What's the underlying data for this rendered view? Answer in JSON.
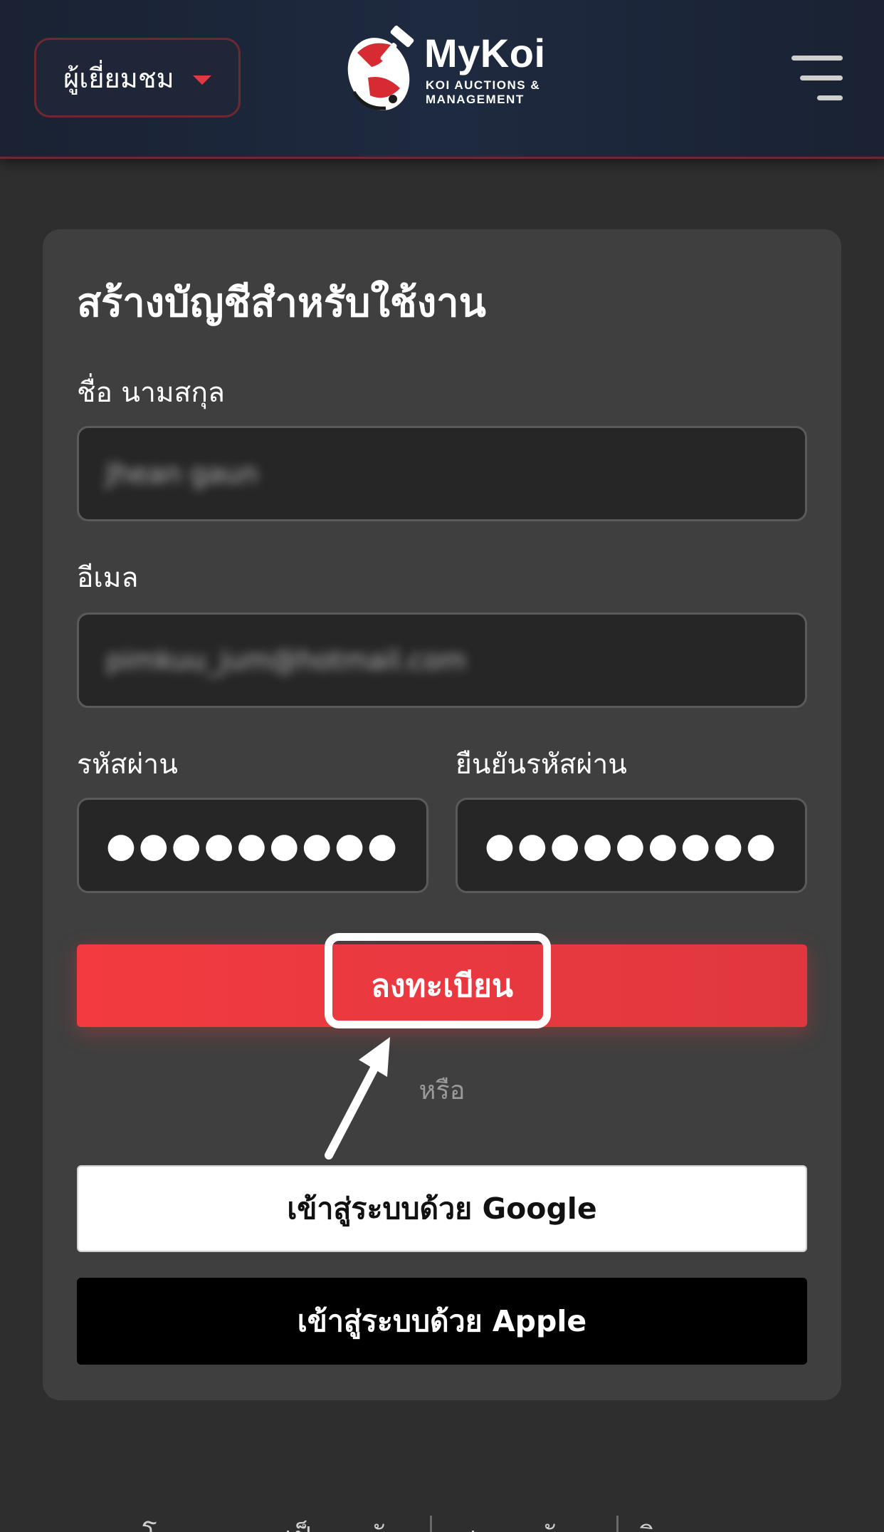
{
  "header": {
    "role_selector": {
      "value": "ผู้เยี่ยมชม"
    },
    "logo": {
      "title": "MyKoi",
      "subtitle": "KOI AUCTIONS & MANAGEMENT"
    }
  },
  "form": {
    "title": "สร้างบัญชีสำหรับใช้งาน",
    "name_label": "ชื่อ นามสกุล",
    "name_value": "Jhean  gaun",
    "email_label": "อีเมล",
    "email_value": "pimkuu_jum@hotmail.com",
    "password_label": "รหัสผ่าน",
    "password_value": "●●●●●●●●●",
    "confirm_label": "ยืนยันรหัสผ่าน",
    "confirm_value": "●●●●●●●●●",
    "register_label": "ลงทะเบียน",
    "or_text": "หรือ",
    "google_label": "เข้าสู่ระบบด้วย Google",
    "apple_label": "เข้าสู่ระบบด้วย Apple"
  },
  "footer": {
    "links": [
      "โ",
      "เป็",
      "ั",
      "เ",
      "ั",
      "ิ"
    ]
  },
  "colors": {
    "accent": "#e83a40",
    "background": "#2e2e2e",
    "card": "#3f3f3f",
    "header": "#1c2639"
  },
  "icons": [
    "caret-down-icon",
    "koi-logo-icon",
    "hamburger-menu-icon",
    "annotation-arrow-icon"
  ]
}
